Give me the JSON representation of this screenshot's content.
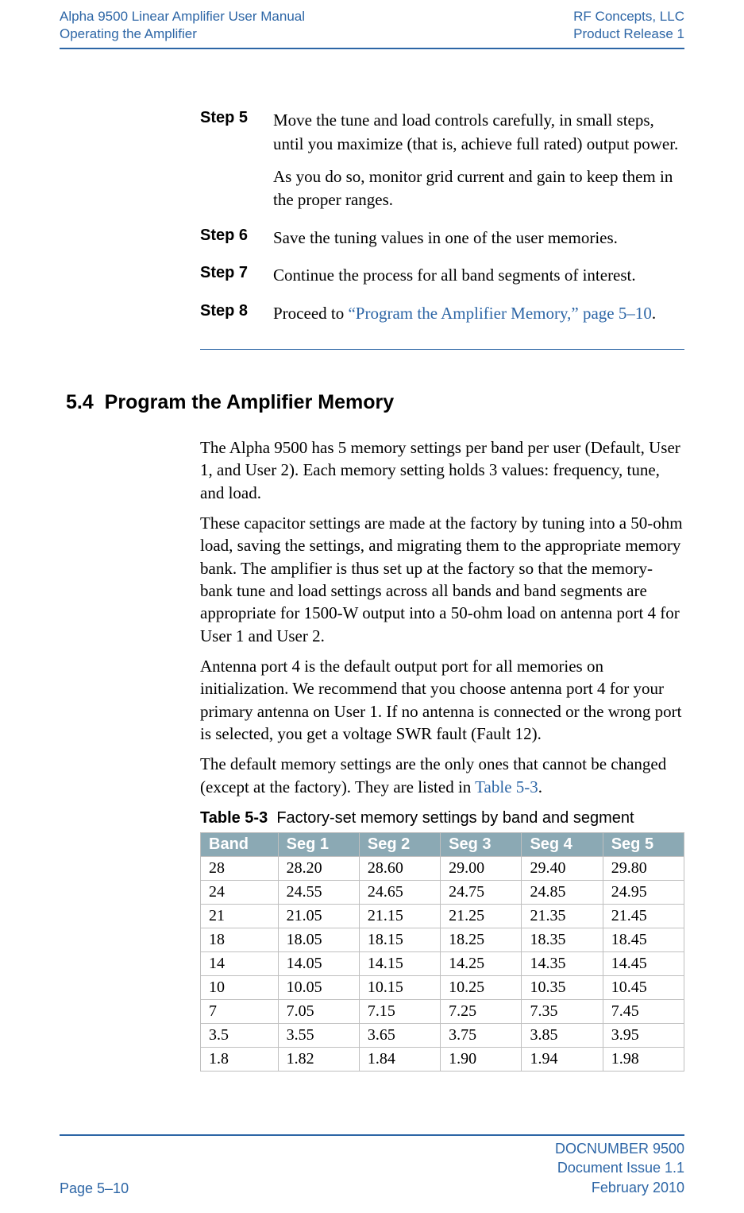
{
  "header": {
    "left1": "Alpha 9500 Linear Amplifier User Manual",
    "left2": "Operating the Amplifier",
    "right1": "RF Concepts, LLC",
    "right2": "Product Release 1"
  },
  "steps": {
    "s5": {
      "label": "Step 5",
      "p1": "Move the tune and load controls carefully, in small steps, until you maximize (that is, achieve full rated) output power.",
      "p2": "As you do so, monitor grid current and gain to keep them in the proper ranges."
    },
    "s6": {
      "label": "Step 6",
      "p1": "Save the tuning values in one of the user memories."
    },
    "s7": {
      "label": "Step 7",
      "p1": "Continue the process for all band segments of interest."
    },
    "s8": {
      "label": "Step 8",
      "p1_before": "Proceed to ",
      "p1_link": "“Program the Amplifier Memory,” page 5–10",
      "p1_after": "."
    }
  },
  "section": {
    "number": "5.4",
    "title": "Program the Amplifier Memory"
  },
  "body": {
    "p1": "The Alpha 9500 has 5 memory settings per band per user (Default, User 1, and User 2). Each memory setting holds 3 values: frequency, tune, and load.",
    "p2": "These capacitor settings are made at the factory by tuning into a 50-ohm load, saving the settings, and migrating them to the appropriate memory bank. The amplifier is thus set up at the factory so that the memory-bank tune and load settings across all bands and band segments are appropriate for 1500-W output into a 50-ohm load on antenna port 4 for User 1 and User 2.",
    "p3": "Antenna port 4 is the default output port for all memories on initialization. We recommend that you choose antenna port 4 for your primary antenna on User 1. If no antenna is connected or the wrong port is selected, you get a voltage SWR fault (Fault 12).",
    "p4_before": "The default memory settings are the only ones that cannot be changed (except at the factory). They are listed in ",
    "p4_link": "Table 5-3",
    "p4_after": "."
  },
  "table": {
    "caption_label": "Table 5-3",
    "caption_text": "Factory-set memory settings by band and segment",
    "headers": [
      "Band",
      "Seg 1",
      "Seg 2",
      "Seg 3",
      "Seg 4",
      "Seg 5"
    ],
    "rows": [
      [
        "28",
        "28.20",
        "28.60",
        "29.00",
        "29.40",
        "29.80"
      ],
      [
        "24",
        "24.55",
        "24.65",
        "24.75",
        "24.85",
        "24.95"
      ],
      [
        "21",
        "21.05",
        "21.15",
        "21.25",
        "21.35",
        "21.45"
      ],
      [
        "18",
        "18.05",
        "18.15",
        "18.25",
        "18.35",
        "18.45"
      ],
      [
        "14",
        "14.05",
        "14.15",
        "14.25",
        "14.35",
        "14.45"
      ],
      [
        "10",
        "10.05",
        "10.15",
        "10.25",
        "10.35",
        "10.45"
      ],
      [
        "7",
        "7.05",
        "7.15",
        "7.25",
        "7.35",
        "7.45"
      ],
      [
        "3.5",
        "3.55",
        "3.65",
        "3.75",
        "3.85",
        "3.95"
      ],
      [
        "1.8",
        "1.82",
        "1.84",
        "1.90",
        "1.94",
        "1.98"
      ]
    ]
  },
  "footer": {
    "page": "Page 5–10",
    "doc": "DOCNUMBER 9500",
    "issue": "Document Issue 1.1",
    "date": "February 2010"
  },
  "chart_data": {
    "type": "table",
    "title": "Factory-set memory settings by band and segment",
    "columns": [
      "Band",
      "Seg 1",
      "Seg 2",
      "Seg 3",
      "Seg 4",
      "Seg 5"
    ],
    "rows": [
      {
        "Band": "28",
        "Seg 1": 28.2,
        "Seg 2": 28.6,
        "Seg 3": 29.0,
        "Seg 4": 29.4,
        "Seg 5": 29.8
      },
      {
        "Band": "24",
        "Seg 1": 24.55,
        "Seg 2": 24.65,
        "Seg 3": 24.75,
        "Seg 4": 24.85,
        "Seg 5": 24.95
      },
      {
        "Band": "21",
        "Seg 1": 21.05,
        "Seg 2": 21.15,
        "Seg 3": 21.25,
        "Seg 4": 21.35,
        "Seg 5": 21.45
      },
      {
        "Band": "18",
        "Seg 1": 18.05,
        "Seg 2": 18.15,
        "Seg 3": 18.25,
        "Seg 4": 18.35,
        "Seg 5": 18.45
      },
      {
        "Band": "14",
        "Seg 1": 14.05,
        "Seg 2": 14.15,
        "Seg 3": 14.25,
        "Seg 4": 14.35,
        "Seg 5": 14.45
      },
      {
        "Band": "10",
        "Seg 1": 10.05,
        "Seg 2": 10.15,
        "Seg 3": 10.25,
        "Seg 4": 10.35,
        "Seg 5": 10.45
      },
      {
        "Band": "7",
        "Seg 1": 7.05,
        "Seg 2": 7.15,
        "Seg 3": 7.25,
        "Seg 4": 7.35,
        "Seg 5": 7.45
      },
      {
        "Band": "3.5",
        "Seg 1": 3.55,
        "Seg 2": 3.65,
        "Seg 3": 3.75,
        "Seg 4": 3.85,
        "Seg 5": 3.95
      },
      {
        "Band": "1.8",
        "Seg 1": 1.82,
        "Seg 2": 1.84,
        "Seg 3": 1.9,
        "Seg 4": 1.94,
        "Seg 5": 1.98
      }
    ]
  }
}
